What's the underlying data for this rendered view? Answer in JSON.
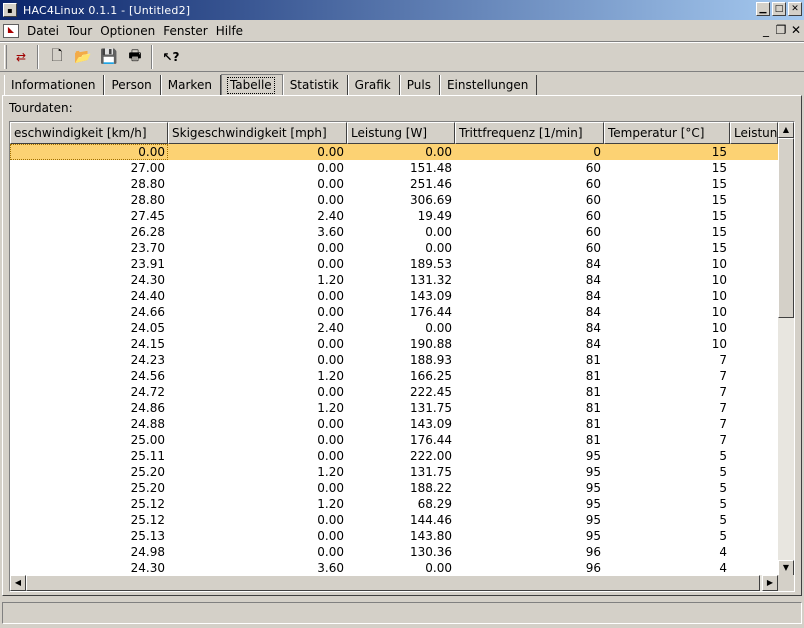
{
  "window": {
    "title": "HAC4Linux 0.1.1 - [Untitled2]",
    "minimize": "▁",
    "maximize": "□",
    "close": "✕"
  },
  "menu": {
    "items": [
      {
        "label": "Datei",
        "key": "D"
      },
      {
        "label": "Tour",
        "key": "T"
      },
      {
        "label": "Optionen",
        "key": "O"
      },
      {
        "label": "Fenster",
        "key": "F"
      },
      {
        "label": "Hilfe",
        "key": "H"
      }
    ],
    "mdi_minimize": "_",
    "mdi_restore": "❐",
    "mdi_close": "✕"
  },
  "toolbar": {
    "buttons": [
      {
        "name": "transfer",
        "icon": "transfer-icon",
        "glyph": "⇄"
      },
      {
        "name": "new",
        "icon": "new-file-icon",
        "glyph": "🗋"
      },
      {
        "name": "open",
        "icon": "open-folder-icon",
        "glyph": "📂"
      },
      {
        "name": "save",
        "icon": "save-icon",
        "glyph": "💾"
      },
      {
        "name": "print",
        "icon": "print-icon",
        "glyph": "🖶"
      },
      {
        "name": "help",
        "icon": "context-help-icon",
        "glyph": "↖?"
      }
    ]
  },
  "tabs": [
    {
      "label": "Informationen",
      "active": false
    },
    {
      "label": "Person",
      "active": false
    },
    {
      "label": "Marken",
      "active": false
    },
    {
      "label": "Tabelle",
      "active": true
    },
    {
      "label": "Statistik",
      "active": false
    },
    {
      "label": "Grafik",
      "active": false
    },
    {
      "label": "Puls",
      "active": false
    },
    {
      "label": "Einstellungen",
      "active": false
    }
  ],
  "section_label": "Tourdaten:",
  "table": {
    "columns": [
      "eschwindigkeit [km/h]",
      "Skigeschwindigkeit [mph]",
      "Leistung [W]",
      "Trittfrequenz [1/min]",
      "Temperatur [°C]",
      "Leistung"
    ],
    "rows": [
      [
        "0.00",
        "0.00",
        "0.00",
        "0",
        "15"
      ],
      [
        "27.00",
        "0.00",
        "151.48",
        "60",
        "15"
      ],
      [
        "28.80",
        "0.00",
        "251.46",
        "60",
        "15"
      ],
      [
        "28.80",
        "0.00",
        "306.69",
        "60",
        "15"
      ],
      [
        "27.45",
        "2.40",
        "19.49",
        "60",
        "15"
      ],
      [
        "26.28",
        "3.60",
        "0.00",
        "60",
        "15"
      ],
      [
        "23.70",
        "0.00",
        "0.00",
        "60",
        "15"
      ],
      [
        "23.91",
        "0.00",
        "189.53",
        "84",
        "10"
      ],
      [
        "24.30",
        "1.20",
        "131.32",
        "84",
        "10"
      ],
      [
        "24.40",
        "0.00",
        "143.09",
        "84",
        "10"
      ],
      [
        "24.66",
        "0.00",
        "176.44",
        "84",
        "10"
      ],
      [
        "24.05",
        "2.40",
        "0.00",
        "84",
        "10"
      ],
      [
        "24.15",
        "0.00",
        "190.88",
        "84",
        "10"
      ],
      [
        "24.23",
        "0.00",
        "188.93",
        "81",
        "7"
      ],
      [
        "24.56",
        "1.20",
        "166.25",
        "81",
        "7"
      ],
      [
        "24.72",
        "0.00",
        "222.45",
        "81",
        "7"
      ],
      [
        "24.86",
        "1.20",
        "131.75",
        "81",
        "7"
      ],
      [
        "24.88",
        "0.00",
        "143.09",
        "81",
        "7"
      ],
      [
        "25.00",
        "0.00",
        "176.44",
        "81",
        "7"
      ],
      [
        "25.11",
        "0.00",
        "222.00",
        "95",
        "5"
      ],
      [
        "25.20",
        "1.20",
        "131.75",
        "95",
        "5"
      ],
      [
        "25.20",
        "0.00",
        "188.22",
        "95",
        "5"
      ],
      [
        "25.12",
        "1.20",
        "68.29",
        "95",
        "5"
      ],
      [
        "25.12",
        "0.00",
        "144.46",
        "95",
        "5"
      ],
      [
        "25.13",
        "0.00",
        "143.80",
        "95",
        "5"
      ],
      [
        "24.98",
        "0.00",
        "130.36",
        "96",
        "4"
      ],
      [
        "24.30",
        "3.60",
        "0.00",
        "96",
        "4"
      ]
    ],
    "selected_row": 0
  },
  "colors": {
    "selection": "#fcd273",
    "titlebar": "#0a246a",
    "face": "#d4d0c8"
  }
}
